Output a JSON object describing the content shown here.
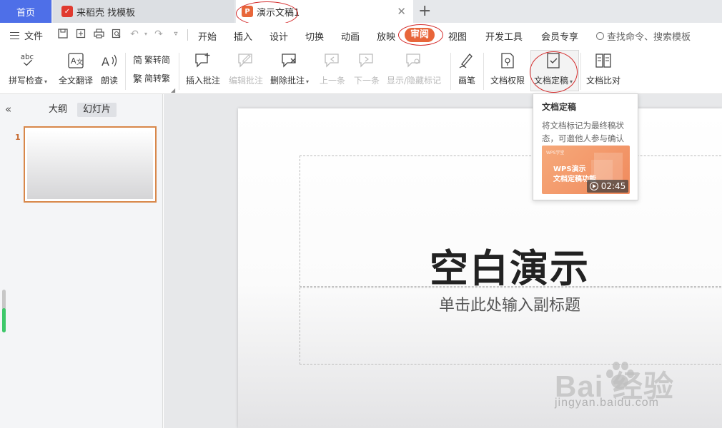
{
  "tabs": {
    "home": "首页",
    "straw": "来稻壳 找模板",
    "doc": "演示文稿1"
  },
  "menu": {
    "file": "文件",
    "items": [
      "开始",
      "插入",
      "设计",
      "切换",
      "动画",
      "放映",
      "审阅",
      "视图",
      "开发工具",
      "会员专享"
    ],
    "search_placeholder": "查找命令、搜索模板"
  },
  "ribbon": {
    "spell_check": "拼写检查",
    "translate": "全文翻译",
    "read_aloud": "朗读",
    "trad_simp": "繁转简",
    "simp_trad": "简转繁",
    "insert_comment": "插入批注",
    "edit_comment": "编辑批注",
    "delete_comment": "删除批注",
    "prev": "上一条",
    "next": "下一条",
    "show_hide_marks": "显示/隐藏标记",
    "pen": "画笔",
    "doc_permission": "文档权限",
    "doc_finalize": "文档定稿",
    "doc_compare": "文档比对"
  },
  "left_panel": {
    "tab_outline": "大纲",
    "tab_slides": "幻灯片",
    "slide_number": "1"
  },
  "slide": {
    "title": "空白演示",
    "subtitle": "单击此处输入副标题"
  },
  "tooltip": {
    "title": "文档定稿",
    "description": "将文档标记为最终稿状态，可邀他人参与确认",
    "video_tag": "WPS学堂",
    "video_line1": "WPS演示",
    "video_line2": "文档定稿功能",
    "duration": "02:45"
  },
  "watermark": {
    "brand": "Bai 经验",
    "url": "jingyan.baidu.com"
  },
  "colors": {
    "home_tab": "#4e6fe8",
    "accent": "#e8663a",
    "annotation": "#d42a2a",
    "scroll_thumb": "#3ec86a"
  },
  "icons": {
    "tab_straw": "straw-logo-icon",
    "tab_ppt": "presentation-logo-icon",
    "close": "close-icon",
    "new_tab": "plus-icon",
    "search": "search-icon"
  }
}
